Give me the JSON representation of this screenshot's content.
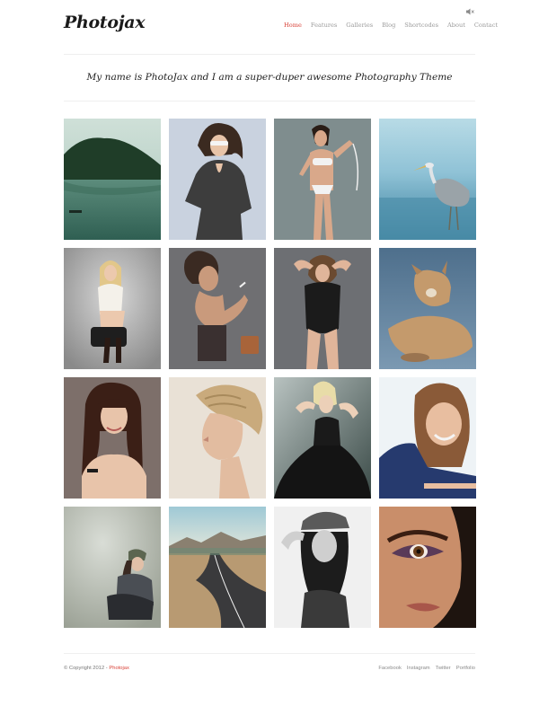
{
  "header": {
    "logo": "Photojax",
    "nav": [
      "Home",
      "Features",
      "Galleries",
      "Blog",
      "Shortcodes",
      "About",
      "Contact"
    ]
  },
  "tagline": "My name is PhotoJax and I am a super-duper awesome Photography Theme",
  "gallery": {
    "photos": [
      "lake-landscape",
      "woman-sunglasses-dark-dress",
      "woman-white-bikini",
      "heron-in-water",
      "blonde-woman-seated",
      "woman-with-cigarette",
      "woman-black-bodysuit",
      "cougar-lying",
      "brunette-woman-bangs",
      "woman-braided-hair-profile",
      "blonde-woman-black-gown",
      "smiling-woman-navy-top",
      "woman-sitting-cap",
      "desert-road",
      "woman-grey-cap-bw",
      "eye-makeup-closeup"
    ]
  },
  "footer": {
    "copyright": "© Copyright 2012 -",
    "brand": "Photojax",
    "links": [
      "Facebook",
      "Instagram",
      "Twitter",
      "Portfolio"
    ]
  }
}
